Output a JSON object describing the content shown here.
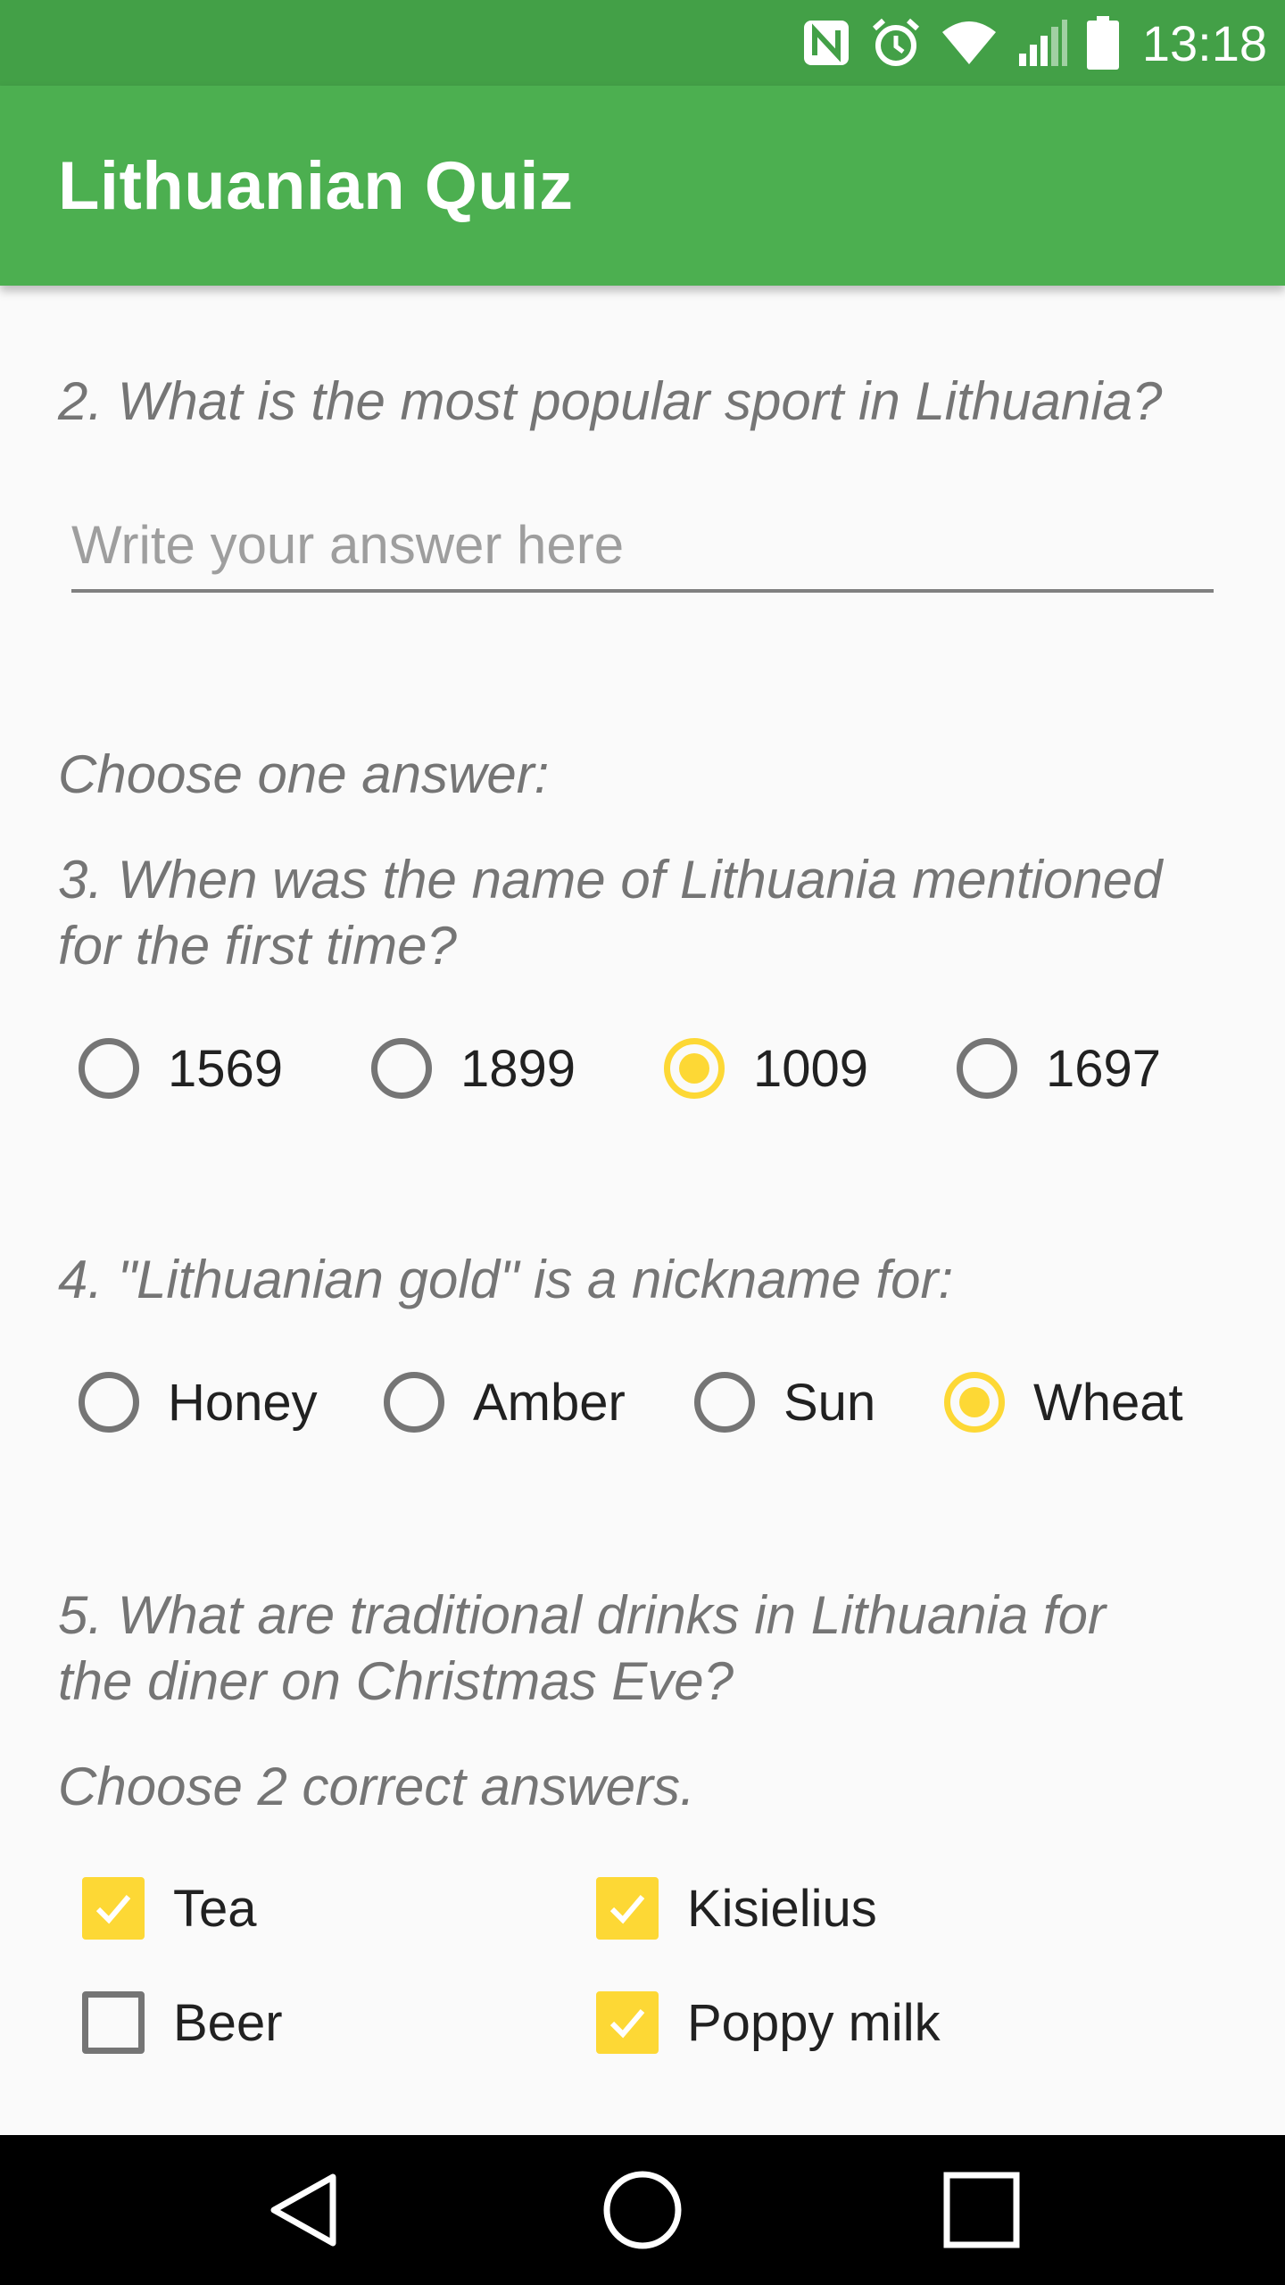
{
  "status_bar": {
    "time": "13:18",
    "icons": [
      "nfc-icon",
      "alarm-icon",
      "wifi-icon",
      "signal-icon",
      "battery-icon"
    ]
  },
  "app_bar": {
    "title": "Lithuanian Quiz",
    "color": "#4caf50"
  },
  "q2": {
    "question": "2. What is the most popular sport in Lithuania?",
    "answer_value": "",
    "placeholder": "Write your answer here"
  },
  "q3": {
    "instruction": "Choose one answer:",
    "question_line1": "3. When was the name of Lithuania mentioned",
    "question_line2": "for the first time?",
    "options": [
      {
        "label": "1569",
        "checked": false
      },
      {
        "label": "1899",
        "checked": false
      },
      {
        "label": "1009",
        "checked": true
      },
      {
        "label": "1697",
        "checked": false
      }
    ]
  },
  "q4": {
    "question": "4. \"Lithuanian gold\" is a nickname for:",
    "options": [
      {
        "label": "Honey",
        "checked": false
      },
      {
        "label": "Amber",
        "checked": false
      },
      {
        "label": "Sun",
        "checked": false
      },
      {
        "label": "Wheat",
        "checked": true
      }
    ]
  },
  "q5": {
    "question_line1": "5. What are traditional drinks in Lithuania for",
    "question_line2": "the diner on Christmas Eve?",
    "instruction": "Choose 2 correct answers.",
    "options": [
      {
        "label": "Tea",
        "checked": true
      },
      {
        "label": "Kisielius",
        "checked": true
      },
      {
        "label": "Beer",
        "checked": false
      },
      {
        "label": "Poppy milk",
        "checked": true
      }
    ]
  },
  "accent_color": "#fdd835",
  "nav_bar": {
    "icons": [
      "back-icon",
      "home-icon",
      "recents-icon"
    ]
  }
}
